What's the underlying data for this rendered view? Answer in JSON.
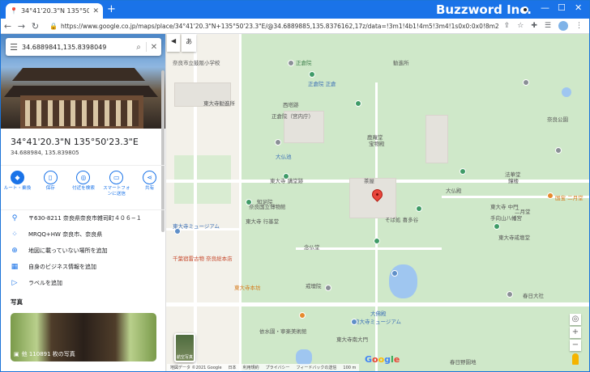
{
  "browser": {
    "tab_title": "34°41'20.3\"N 135°50'23.3\"E - Go...",
    "new_tab": "+",
    "brand": "Buzzword Inc.",
    "window_controls": [
      "—",
      "☐",
      "✕"
    ],
    "url": "https://www.google.co.jp/maps/place/34°41'20.3\"N+135°50'23.3\"E/@34.6889885,135.8376162,17z/data=!3m1!4b1!4m5!3m4!1s0x0:0x0!8m2!3d34.6889841!4d135.8398049?hl=ja"
  },
  "search": {
    "query": "34.6889841,135.8398049"
  },
  "place": {
    "title": "34°41'20.3\"N 135°50'23.3\"E",
    "subtitle": "34.688984, 135.839805"
  },
  "actions": [
    {
      "label": "ルート・乗換",
      "icon": "directions-icon"
    },
    {
      "label": "保存",
      "icon": "bookmark-icon"
    },
    {
      "label": "付近を検索",
      "icon": "nearby-icon"
    },
    {
      "label": "スマートフォンに送信",
      "icon": "phone-icon"
    },
    {
      "label": "共有",
      "icon": "share-icon"
    }
  ],
  "info_rows": [
    {
      "text": "〒630-8211 奈良県奈良市雑司町４０６−１",
      "icon": "pin-icon"
    },
    {
      "text": "MRQQ+HW 奈良市、奈良県",
      "icon": "plus-code-icon"
    },
    {
      "text": "地図に載っていない場所を追加",
      "icon": "add-place-icon"
    },
    {
      "text": "自身のビジネス情報を追加",
      "icon": "business-icon"
    },
    {
      "text": "ラベルを追加",
      "icon": "label-icon"
    }
  ],
  "photos": {
    "heading": "写真",
    "caption": "他 110891 枚の写真"
  },
  "map": {
    "language_button": "あ",
    "satellite_label": "航空写真",
    "logo": "Google",
    "footer": [
      "地図データ ©2021 Google",
      "日本",
      "利用規約",
      "プライバシー",
      "フィードバックの送信",
      "100 m"
    ],
    "labels": [
      "奈良市立鼓阪小学校",
      "正倉院",
      "正倉院 正倉",
      "正倉院（宮内庁）",
      "東大寺勧進所",
      "西塔跡",
      "大仏池",
      "東大寺 講堂跡",
      "依水園・寧楽美術館",
      "東大寺南大門",
      "春日野園地",
      "大仏殿",
      "鐘楼",
      "手向山八幡宮",
      "春日大社",
      "奈良公園",
      "東大寺ミュージアム",
      "奈良国立博物館",
      "東大寺戒壇堂",
      "法華堂",
      "国宝 二月堂",
      "茶屋",
      "東大寺 中門",
      "二月堂",
      "東大寺本坊",
      "そば処 喜多谷",
      "大佛殿",
      "東大寺ミュージアム",
      "千葉宿雷古物 奈良総本店",
      "鹿庵堂",
      "勧進所",
      "知足院",
      "東大寺 行基堂",
      "戒壇院",
      "念仏堂",
      "宝物殿"
    ]
  },
  "colors": {
    "chrome": "#1a73e8",
    "accent": "#1a73e8",
    "park": "#cfe8c9",
    "water": "#9fc6f0",
    "marker": "#e8453c"
  }
}
